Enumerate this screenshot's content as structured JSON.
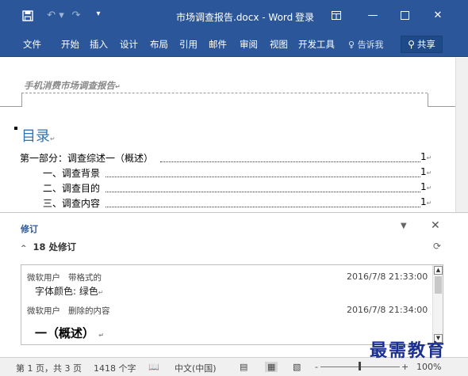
{
  "titlebar": {
    "doc_title": "市场调查报告.docx - Word",
    "login_label": "登录",
    "save_icon": "save-icon",
    "undo_icon": "undo-icon",
    "redo_icon": "redo-icon",
    "customize_icon": "customize-icon",
    "min_icon": "minimize-icon",
    "max_icon": "maximize-icon",
    "close_icon": "close-icon",
    "ribbon_display_icon": "ribbon-display-icon",
    "accent": "#2b579a"
  },
  "ribbon": {
    "tabs": [
      "文件",
      "开始",
      "插入",
      "设计",
      "布局",
      "引用",
      "邮件",
      "审阅",
      "视图",
      "开发工具"
    ],
    "tell_me": "告诉我",
    "share": "共享"
  },
  "document": {
    "header_text": "手机消费市场调查报告",
    "toc_title": "目录",
    "toc": [
      {
        "text": "第一部分：调查综述一（概述）",
        "page": "1"
      },
      {
        "text": "一、调查背景",
        "page": "1"
      },
      {
        "text": "二、调查目的",
        "page": "1"
      },
      {
        "text": "三、调查内容",
        "page": "1"
      }
    ]
  },
  "revisions": {
    "title": "修订",
    "count_label": "18 处修订",
    "items": [
      {
        "author": "微软用户",
        "action": "带格式的",
        "time": "2016/7/8 21:33:00",
        "detail": "字体颜色: 绿色"
      },
      {
        "author": "微软用户",
        "action": "删除的内容",
        "time": "2016/7/8 21:34:00",
        "detail": "一（概述）"
      }
    ]
  },
  "statusbar": {
    "page_info": "第 1 页，共 3 页",
    "word_count": "1418 个字",
    "language": "中文(中国)",
    "zoom_minus": "-",
    "zoom_plus": "+",
    "zoom": "100%",
    "zoom_fraction": 0.5
  },
  "watermark": "最需教育"
}
